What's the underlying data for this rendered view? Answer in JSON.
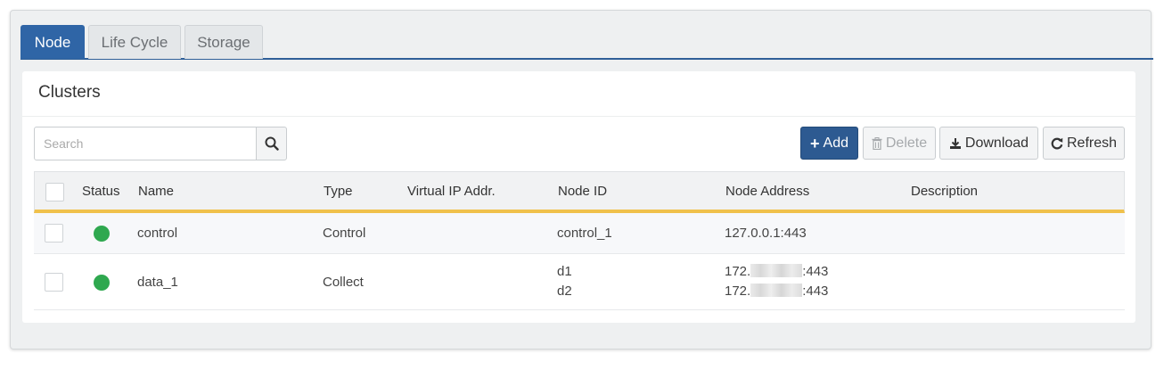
{
  "tabs": [
    {
      "label": "Node",
      "active": true
    },
    {
      "label": "Life Cycle",
      "active": false
    },
    {
      "label": "Storage",
      "active": false
    }
  ],
  "panel": {
    "title": "Clusters"
  },
  "search": {
    "placeholder": "Search",
    "value": ""
  },
  "toolbar": {
    "add_label": "Add",
    "delete_label": "Delete",
    "download_label": "Download",
    "refresh_label": "Refresh"
  },
  "table": {
    "columns": [
      "Status",
      "Name",
      "Type",
      "Virtual IP Addr.",
      "Node ID",
      "Node Address",
      "Description"
    ],
    "rows": [
      {
        "status": "green",
        "name": "control",
        "type": "Control",
        "vip": "",
        "node_ids": [
          "control_1"
        ],
        "address_prefix": [
          "127.0.0.1:443"
        ],
        "address_suffix": [
          ""
        ],
        "description": ""
      },
      {
        "status": "green",
        "name": "data_1",
        "type": "Collect",
        "vip": "",
        "node_ids": [
          "d1",
          "d2"
        ],
        "address_prefix": [
          "172.",
          "172."
        ],
        "address_suffix": [
          ":443",
          ":443"
        ],
        "description": ""
      }
    ]
  },
  "colors": {
    "accent": "#2f65a6",
    "primary_button": "#2d5a91",
    "header_underline": "#f0c14b",
    "status_ok": "#2fa84f"
  }
}
